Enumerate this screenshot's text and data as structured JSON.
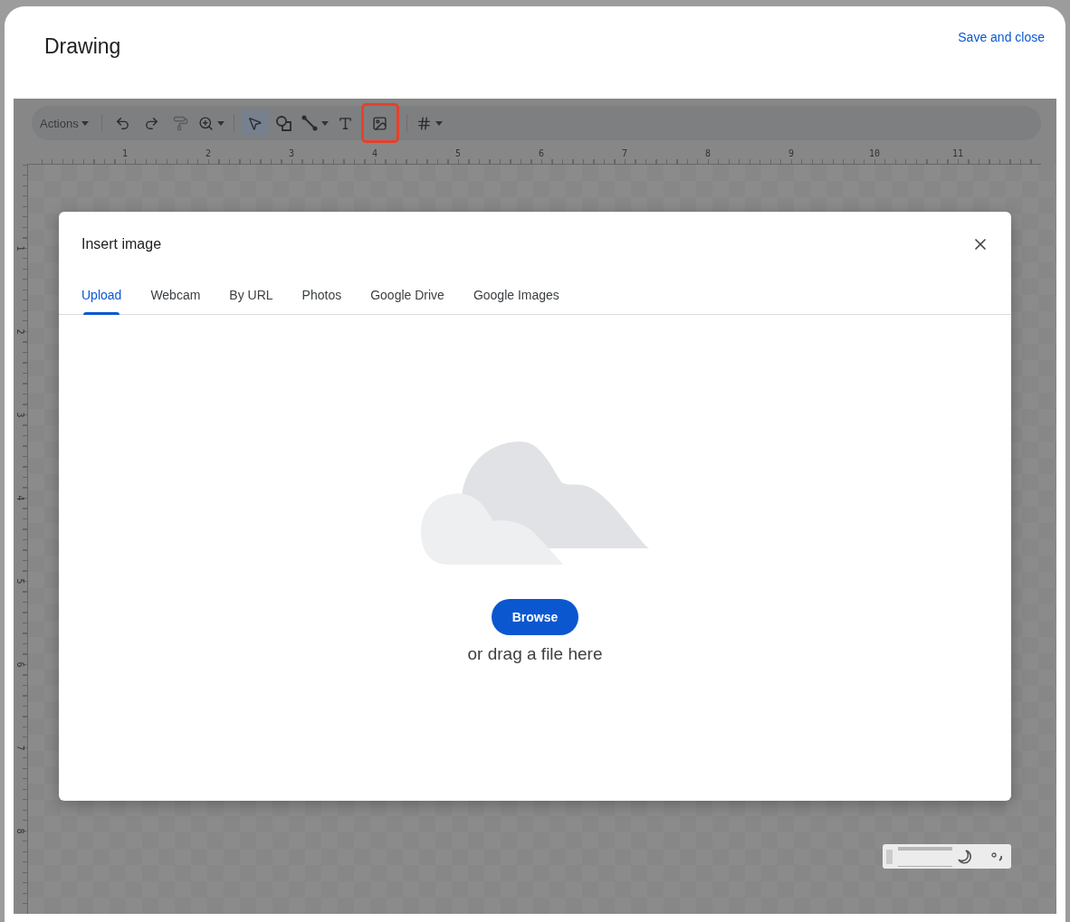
{
  "window": {
    "title": "Drawing",
    "save_button": "Save and close"
  },
  "toolbar": {
    "actions_menu": "Actions",
    "tools": [
      {
        "kind": "undo",
        "selected": false,
        "highlighted": false
      },
      {
        "kind": "redo",
        "selected": false,
        "highlighted": false
      },
      {
        "kind": "paint_format",
        "selected": false,
        "highlighted": false
      },
      {
        "kind": "zoom",
        "selected": false,
        "highlighted": false
      },
      {
        "kind": "select",
        "selected": true,
        "highlighted": false
      },
      {
        "kind": "shape",
        "selected": false,
        "highlighted": false
      },
      {
        "kind": "line",
        "selected": false,
        "highlighted": false
      },
      {
        "kind": "text",
        "selected": false,
        "highlighted": false
      },
      {
        "kind": "image",
        "selected": false,
        "highlighted": true
      },
      {
        "kind": "word_art",
        "selected": false,
        "highlighted": false
      }
    ]
  },
  "ruler": {
    "horizontal": [
      "1",
      "2",
      "3",
      "4",
      "5",
      "6",
      "7",
      "8",
      "9",
      "10",
      "11"
    ],
    "vertical": [
      "1",
      "2",
      "3",
      "4",
      "5",
      "6",
      "7",
      "8"
    ]
  },
  "dialog": {
    "title": "Insert image",
    "tabs": [
      {
        "label": "Upload",
        "selected": true
      },
      {
        "label": "Webcam",
        "selected": false
      },
      {
        "label": "By URL",
        "selected": false
      },
      {
        "label": "Photos",
        "selected": false
      },
      {
        "label": "Google Drive",
        "selected": false
      },
      {
        "label": "Google Images",
        "selected": false
      }
    ],
    "browse_button": "Browse",
    "drop_hint": "or drag a file here"
  }
}
